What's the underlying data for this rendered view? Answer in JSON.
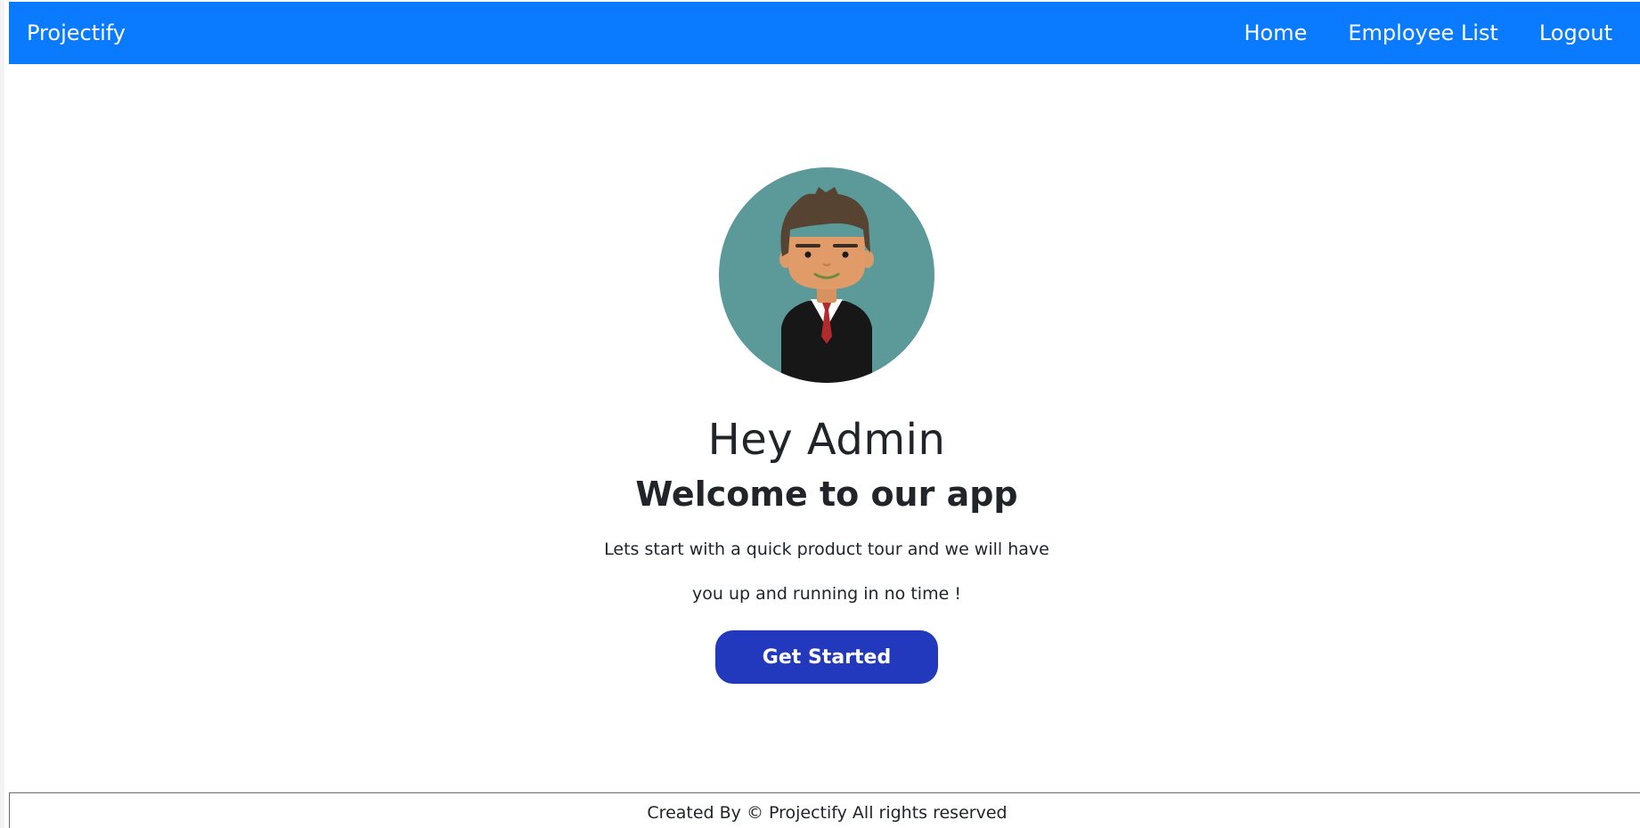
{
  "navbar": {
    "brand": "Projectify",
    "links": [
      {
        "label": "Home"
      },
      {
        "label": "Employee List"
      },
      {
        "label": "Logout"
      }
    ],
    "background_color": "#0a7bff"
  },
  "hero": {
    "avatar_icon": "businessman-avatar-icon",
    "greeting": "Hey Admin",
    "welcome": "Welcome to our app",
    "intro_line_1": "Lets start with a quick product tour and we will have",
    "intro_line_2": "you up and running in no time !",
    "cta_label": "Get Started",
    "cta_color": "#2339bd"
  },
  "footer": {
    "text": "Created By © Projectify All rights reserved"
  }
}
